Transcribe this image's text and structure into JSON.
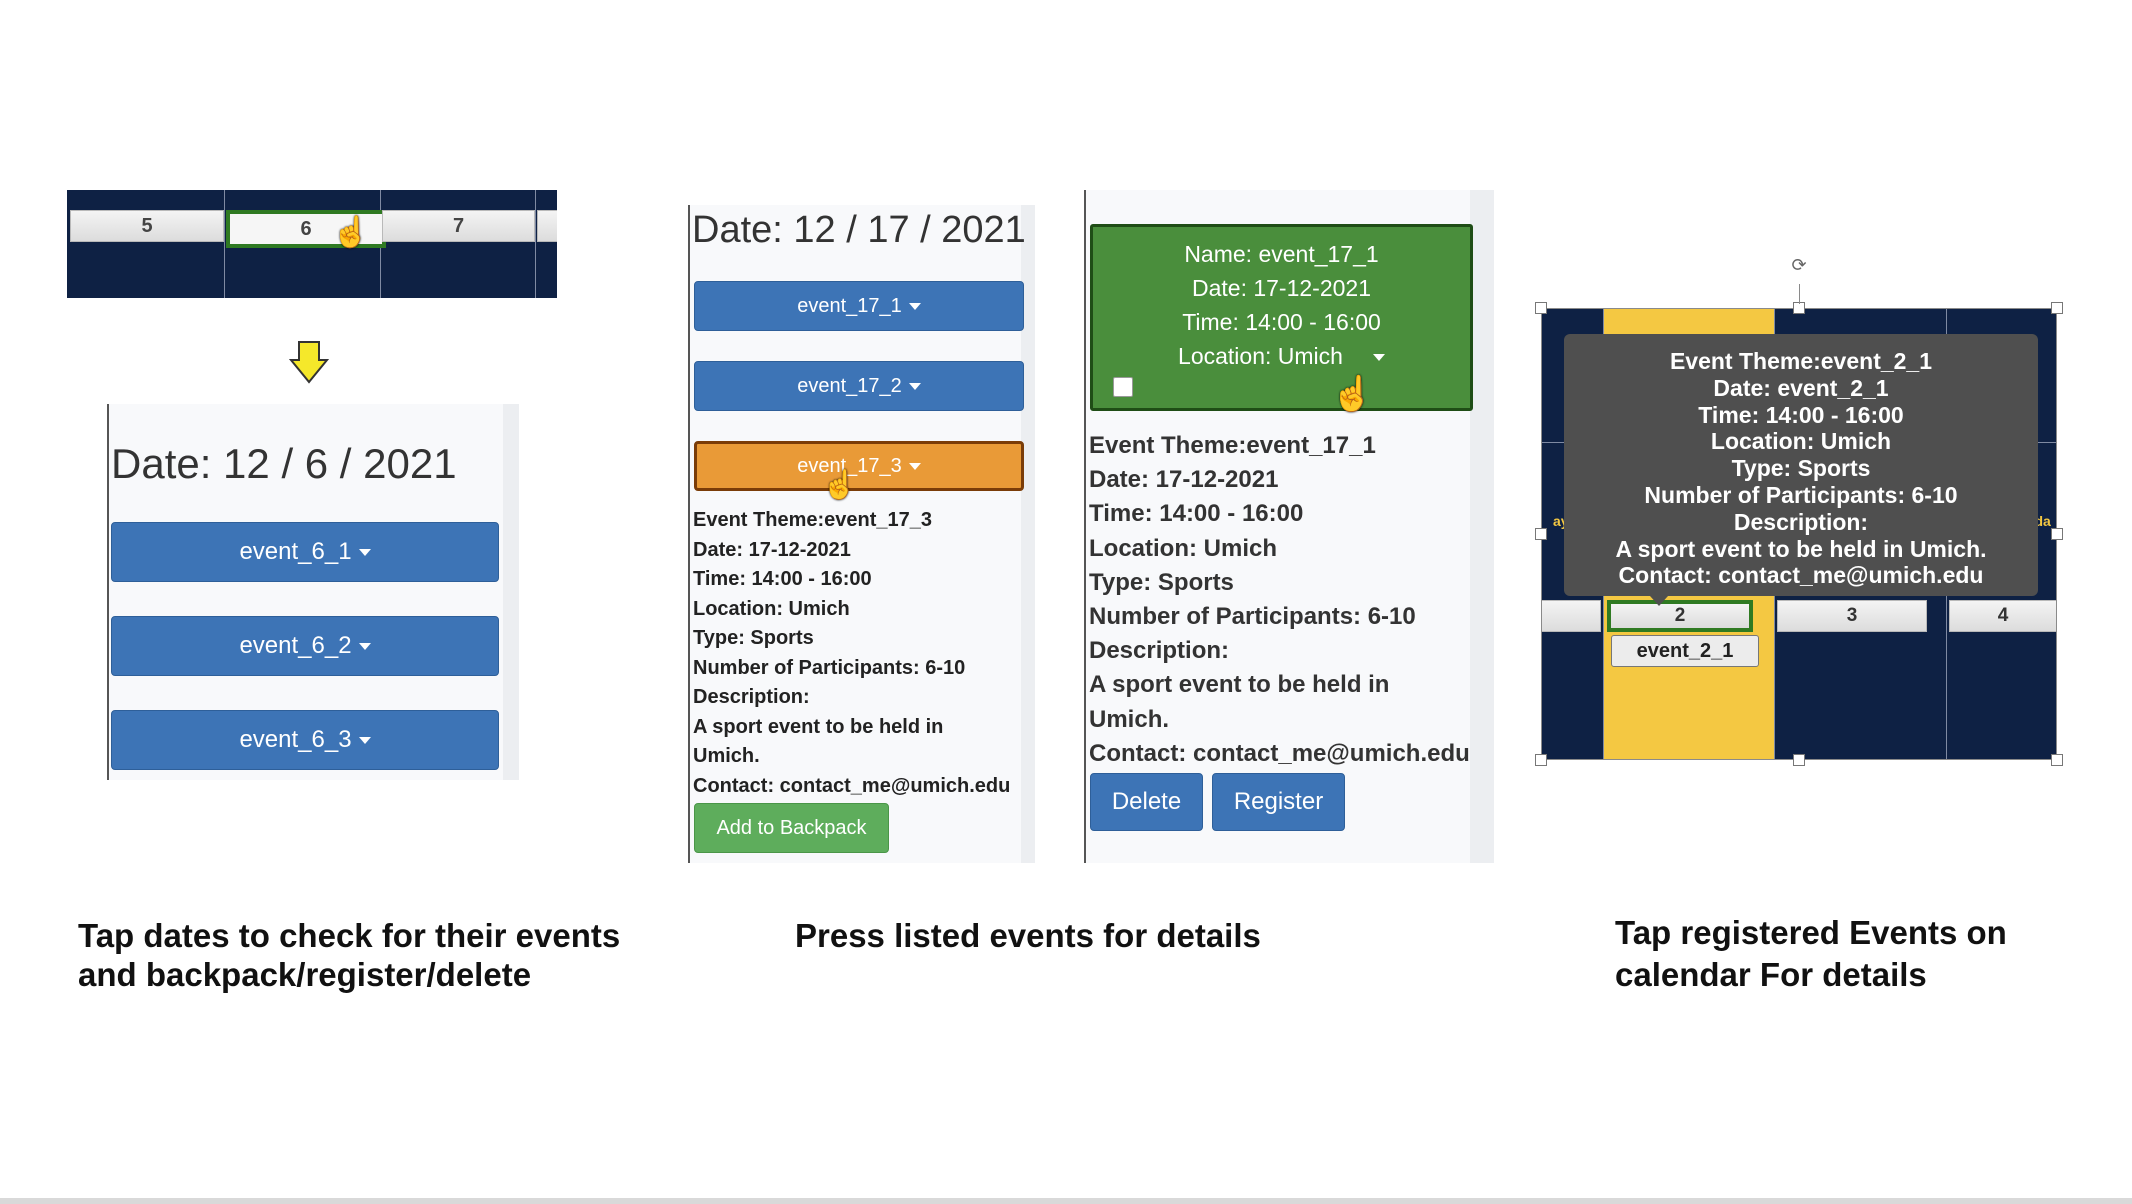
{
  "panel1": {
    "days": [
      "5",
      "6",
      "7"
    ],
    "selected_day": "6",
    "date_header": "Date: 12 / 6 / 2021",
    "events": [
      "event_6_1",
      "event_6_2",
      "event_6_3"
    ]
  },
  "panel2": {
    "date_header": "Date: 12 / 17 / 2021",
    "events": [
      "event_17_1",
      "event_17_2",
      "event_17_3"
    ],
    "active_event": "event_17_3",
    "details": [
      "Event Theme:event_17_3",
      "Date: 17-12-2021",
      "Time: 14:00 - 16:00",
      "Location: Umich",
      "Type: Sports",
      "Number of Participants: 6-10",
      "Description:",
      "A sport event to be held in",
      "Umich.",
      "Contact: contact_me@umich.edu"
    ],
    "add_button": "Add to Backpack"
  },
  "panel3": {
    "card_lines": [
      "Name: event_17_1",
      "Date: 17-12-2021",
      "Time: 14:00 - 16:00",
      "Location: Umich"
    ],
    "details": [
      "Event Theme:event_17_1",
      "Date: 17-12-2021",
      "Time: 14:00 - 16:00",
      "Location: Umich",
      "Type: Sports",
      "Number of Participants: 6-10",
      "Description:",
      "A sport event to be held in",
      "Umich.",
      "Contact: contact_me@umich.edu"
    ],
    "delete_button": "Delete",
    "register_button": "Register"
  },
  "panel4": {
    "days": [
      "2",
      "3",
      "4"
    ],
    "selected_day": "2",
    "event_chip": "event_2_1",
    "side_left": "ay",
    "side_right": "rda",
    "tooltip_lines": [
      "Event Theme:event_2_1",
      "Date: event_2_1",
      "Time: 14:00 - 16:00",
      "Location: Umich",
      "Type: Sports",
      "Number of Participants: 6-10",
      "Description:",
      "A sport event to be held in Umich.",
      "Contact: contact_me@umich.edu"
    ]
  },
  "captions": {
    "c1_line1": "Tap dates to check for their events",
    "c1_line2": "and backpack/register/delete",
    "c2": "Press listed events for details",
    "c3_line1": "Tap registered Events on",
    "c3_line2": "calendar For details"
  },
  "colors": {
    "calendar_navy": "#0e2144",
    "event_blue": "#3d74b6",
    "event_orange": "#e99a37",
    "card_green": "#4a8e3c",
    "highlight_yellow": "#f4c842",
    "tooltip_gray": "#4f4f4f",
    "arrow_yellow": "#f5e82a"
  },
  "icons": [
    "hand-pointer-icon",
    "down-arrow-icon",
    "caret-down-icon",
    "checkbox-icon",
    "rotate-icon"
  ]
}
